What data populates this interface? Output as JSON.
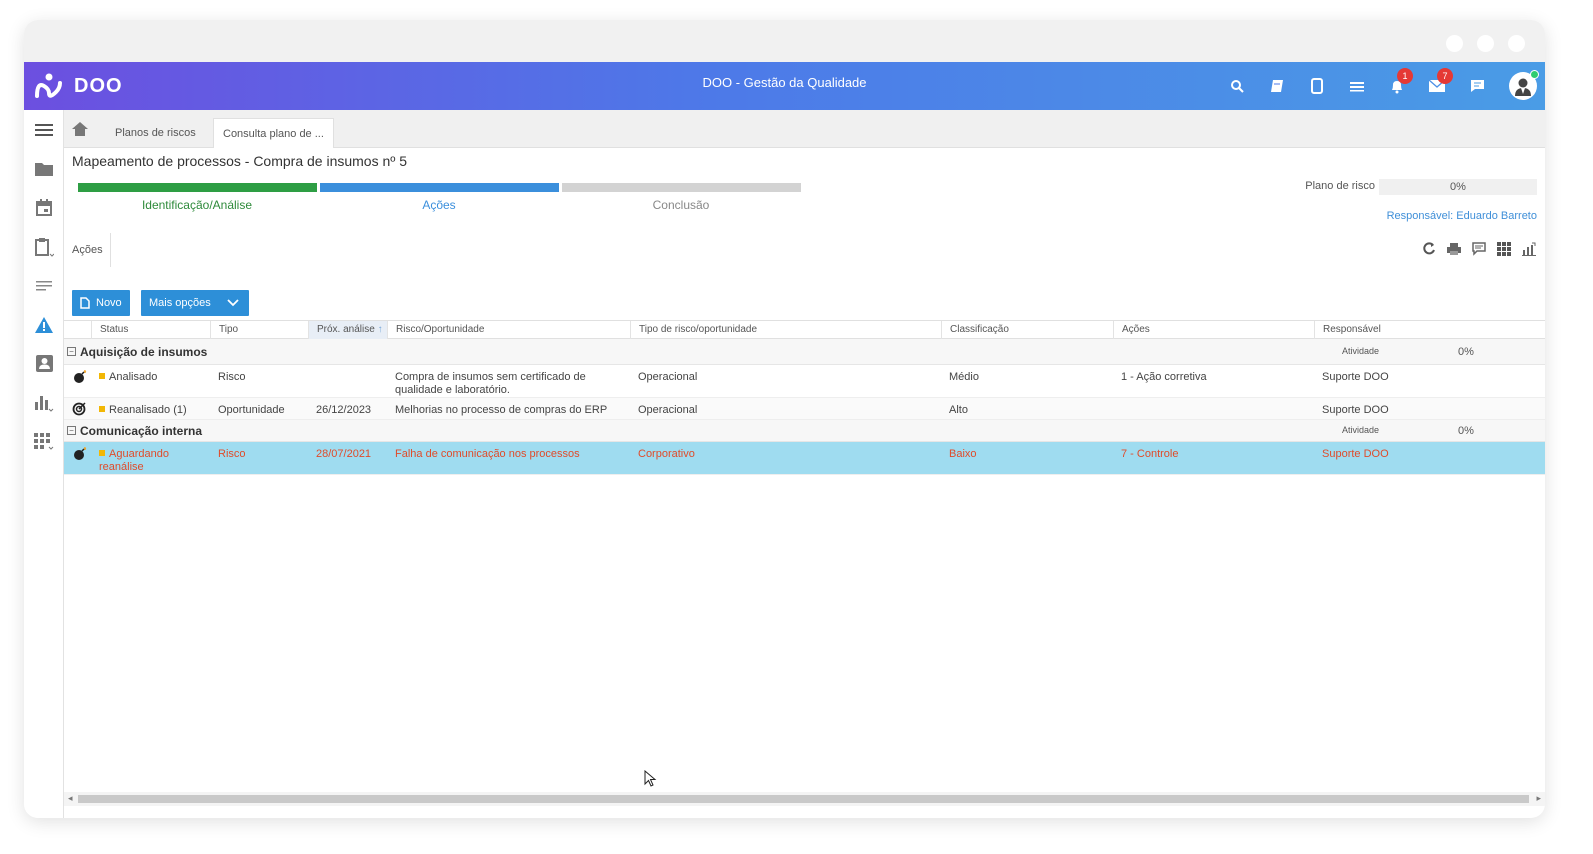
{
  "app": {
    "logo_text": "DOO",
    "title": "DOO - Gestão da Qualidade",
    "badges": {
      "notifications": "1",
      "messages": "7"
    }
  },
  "tabs": {
    "home_icon": "home-icon",
    "items": [
      {
        "label": "Planos de riscos"
      },
      {
        "label": "Consulta plano de ..."
      }
    ]
  },
  "page": {
    "title": "Mapeamento de processos - Compra de insumos nº 5",
    "steps": [
      {
        "label": "Identificação/Análise",
        "color": "#2e9e44",
        "text_color": "#2e8a3a"
      },
      {
        "label": "Ações",
        "color": "#3b8fdc",
        "text_color": "#3b8fdc"
      },
      {
        "label": "Conclusão",
        "color": "#d3d3d3",
        "text_color": "#888888"
      }
    ],
    "plan_label": "Plano de risco",
    "plan_value": "0%",
    "responsavel": "Responsável: Eduardo Barreto",
    "subtab": "Ações"
  },
  "toolbar": {
    "new_label": "Novo",
    "more_label": "Mais opções"
  },
  "grid": {
    "columns": [
      "Status",
      "Tipo",
      "Próx. análise",
      "Risco/Oportunidade",
      "Tipo de risco/oportunidade",
      "Classificação",
      "Ações",
      "Responsável"
    ],
    "groups": [
      {
        "name": "Aquisição de insumos",
        "ativ_label": "Atividade",
        "pct": "0%",
        "rows": [
          {
            "icon": "bomb-icon",
            "status": "Analisado",
            "tipo": "Risco",
            "prox": "",
            "risco": "Compra de insumos sem certificado de qualidade e laboratório.",
            "tipo_risco": "Operacional",
            "classif": "Médio",
            "acoes": "1 - Ação corretiva",
            "resp": "Suporte DOO"
          },
          {
            "icon": "target-icon",
            "status": "Reanalisado (1)",
            "tipo": "Oportunidade",
            "prox": "26/12/2023",
            "risco": "Melhorias no processo de compras do ERP",
            "tipo_risco": "Operacional",
            "classif": "Alto",
            "acoes": "",
            "resp": "Suporte DOO"
          }
        ]
      },
      {
        "name": "Comunicação interna",
        "ativ_label": "Atividade",
        "pct": "0%",
        "rows": [
          {
            "icon": "bomb-icon",
            "status": "Aguardando reanálise",
            "tipo": "Risco",
            "prox": "28/07/2021",
            "risco": "Falha de comunicação nos processos",
            "tipo_risco": "Corporativo",
            "classif": "Baixo",
            "acoes": "7 - Controle",
            "resp": "Suporte DOO"
          }
        ]
      }
    ]
  }
}
